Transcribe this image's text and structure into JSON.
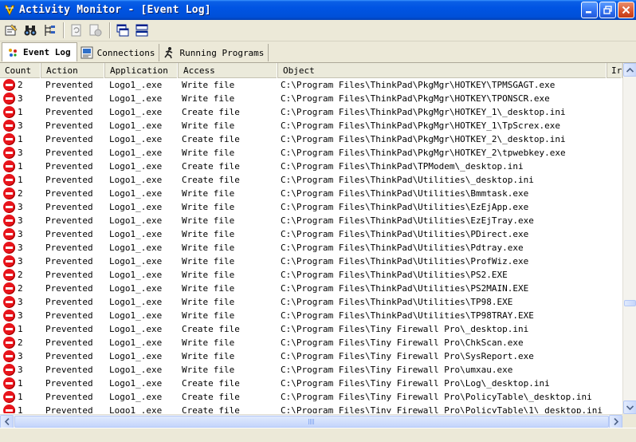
{
  "window": {
    "title": "Activity Monitor - [Event Log]"
  },
  "tabs": [
    {
      "label": "Event Log",
      "icon": "event-log-icon"
    },
    {
      "label": "Connections",
      "icon": "connections-icon"
    },
    {
      "label": "Running Programs",
      "icon": "running-programs-icon"
    }
  ],
  "columns": [
    "Count",
    "Action",
    "Application",
    "Access",
    "Object",
    "Ir"
  ],
  "rows": [
    {
      "count": "2",
      "action": "Prevented",
      "application": "Logo1_.exe",
      "access": "Write file",
      "object": "C:\\Program Files\\ThinkPad\\PkgMgr\\HOTKEY\\TPMSGAGT.exe"
    },
    {
      "count": "3",
      "action": "Prevented",
      "application": "Logo1_.exe",
      "access": "Write file",
      "object": "C:\\Program Files\\ThinkPad\\PkgMgr\\HOTKEY\\TPONSCR.exe"
    },
    {
      "count": "1",
      "action": "Prevented",
      "application": "Logo1_.exe",
      "access": "Create file",
      "object": "C:\\Program Files\\ThinkPad\\PkgMgr\\HOTKEY_1\\_desktop.ini"
    },
    {
      "count": "3",
      "action": "Prevented",
      "application": "Logo1_.exe",
      "access": "Write file",
      "object": "C:\\Program Files\\ThinkPad\\PkgMgr\\HOTKEY_1\\TpScrex.exe"
    },
    {
      "count": "1",
      "action": "Prevented",
      "application": "Logo1_.exe",
      "access": "Create file",
      "object": "C:\\Program Files\\ThinkPad\\PkgMgr\\HOTKEY_2\\_desktop.ini"
    },
    {
      "count": "3",
      "action": "Prevented",
      "application": "Logo1_.exe",
      "access": "Write file",
      "object": "C:\\Program Files\\ThinkPad\\PkgMgr\\HOTKEY_2\\tpwebkey.exe"
    },
    {
      "count": "1",
      "action": "Prevented",
      "application": "Logo1_.exe",
      "access": "Create file",
      "object": "C:\\Program Files\\ThinkPad\\TPModem\\_desktop.ini"
    },
    {
      "count": "1",
      "action": "Prevented",
      "application": "Logo1_.exe",
      "access": "Create file",
      "object": "C:\\Program Files\\ThinkPad\\Utilities\\_desktop.ini"
    },
    {
      "count": "2",
      "action": "Prevented",
      "application": "Logo1_.exe",
      "access": "Write file",
      "object": "C:\\Program Files\\ThinkPad\\Utilities\\Bmmtask.exe"
    },
    {
      "count": "3",
      "action": "Prevented",
      "application": "Logo1_.exe",
      "access": "Write file",
      "object": "C:\\Program Files\\ThinkPad\\Utilities\\EzEjApp.exe"
    },
    {
      "count": "3",
      "action": "Prevented",
      "application": "Logo1_.exe",
      "access": "Write file",
      "object": "C:\\Program Files\\ThinkPad\\Utilities\\EzEjTray.exe"
    },
    {
      "count": "3",
      "action": "Prevented",
      "application": "Logo1_.exe",
      "access": "Write file",
      "object": "C:\\Program Files\\ThinkPad\\Utilities\\PDirect.exe"
    },
    {
      "count": "3",
      "action": "Prevented",
      "application": "Logo1_.exe",
      "access": "Write file",
      "object": "C:\\Program Files\\ThinkPad\\Utilities\\Pdtray.exe"
    },
    {
      "count": "3",
      "action": "Prevented",
      "application": "Logo1_.exe",
      "access": "Write file",
      "object": "C:\\Program Files\\ThinkPad\\Utilities\\ProfWiz.exe"
    },
    {
      "count": "2",
      "action": "Prevented",
      "application": "Logo1_.exe",
      "access": "Write file",
      "object": "C:\\Program Files\\ThinkPad\\Utilities\\PS2.EXE"
    },
    {
      "count": "2",
      "action": "Prevented",
      "application": "Logo1_.exe",
      "access": "Write file",
      "object": "C:\\Program Files\\ThinkPad\\Utilities\\PS2MAIN.EXE"
    },
    {
      "count": "3",
      "action": "Prevented",
      "application": "Logo1_.exe",
      "access": "Write file",
      "object": "C:\\Program Files\\ThinkPad\\Utilities\\TP98.EXE"
    },
    {
      "count": "3",
      "action": "Prevented",
      "application": "Logo1_.exe",
      "access": "Write file",
      "object": "C:\\Program Files\\ThinkPad\\Utilities\\TP98TRAY.EXE"
    },
    {
      "count": "1",
      "action": "Prevented",
      "application": "Logo1_.exe",
      "access": "Create file",
      "object": "C:\\Program Files\\Tiny Firewall Pro\\_desktop.ini"
    },
    {
      "count": "2",
      "action": "Prevented",
      "application": "Logo1_.exe",
      "access": "Write file",
      "object": "C:\\Program Files\\Tiny Firewall Pro\\ChkScan.exe"
    },
    {
      "count": "3",
      "action": "Prevented",
      "application": "Logo1_.exe",
      "access": "Write file",
      "object": "C:\\Program Files\\Tiny Firewall Pro\\SysReport.exe"
    },
    {
      "count": "3",
      "action": "Prevented",
      "application": "Logo1_.exe",
      "access": "Write file",
      "object": "C:\\Program Files\\Tiny Firewall Pro\\umxau.exe"
    },
    {
      "count": "1",
      "action": "Prevented",
      "application": "Logo1_.exe",
      "access": "Create file",
      "object": "C:\\Program Files\\Tiny Firewall Pro\\Log\\_desktop.ini"
    },
    {
      "count": "1",
      "action": "Prevented",
      "application": "Logo1_.exe",
      "access": "Create file",
      "object": "C:\\Program Files\\Tiny Firewall Pro\\PolicyTable\\_desktop.ini"
    },
    {
      "count": "1",
      "action": "Prevented",
      "application": "Logo1_.exe",
      "access": "Create file",
      "object": "C:\\Program Files\\Tiny Firewall Pro\\PolicyTable\\1\\_desktop.ini"
    }
  ],
  "colors": {
    "titlebar": "#0054e3",
    "stop": "#e8141b",
    "background": "#ece9d8"
  }
}
